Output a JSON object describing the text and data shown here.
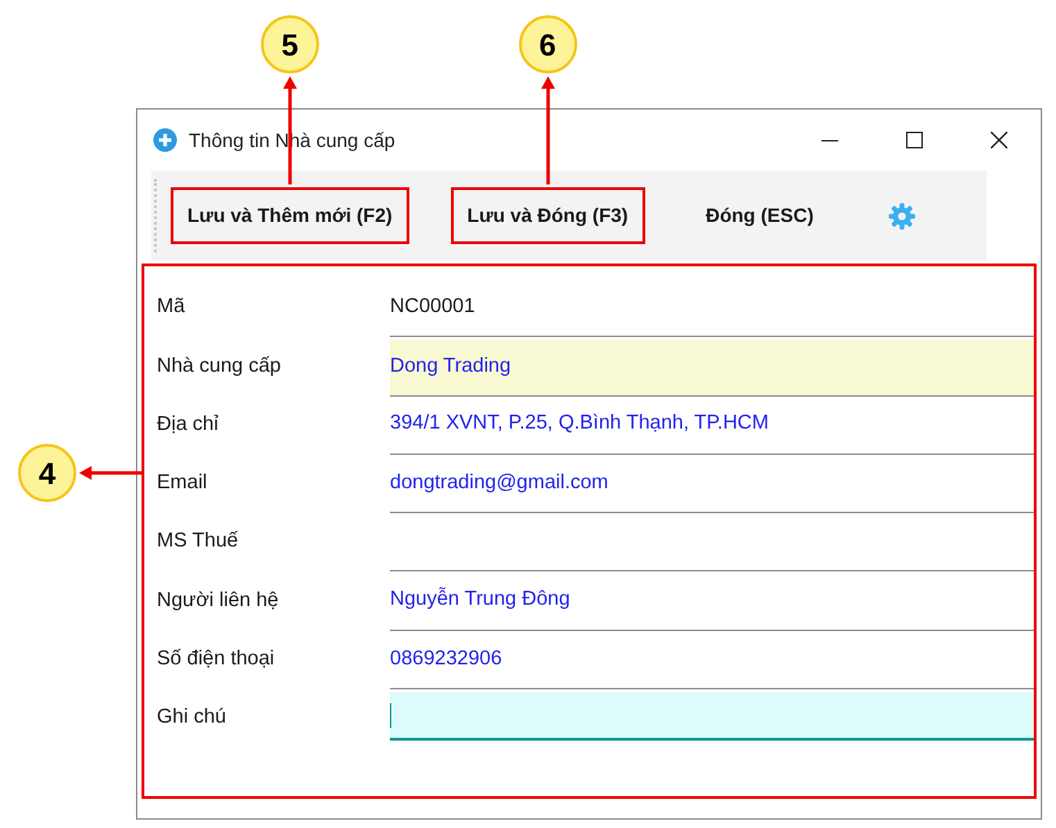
{
  "window": {
    "title": "Thông tin Nhà cung cấp"
  },
  "toolbar": {
    "buttons": [
      {
        "label": "Lưu và Thêm mới (F2)",
        "highlighted": true,
        "callout": "5"
      },
      {
        "label": "Lưu và Đóng (F3)",
        "highlighted": true,
        "callout": "6"
      },
      {
        "label": "Đóng (ESC)",
        "highlighted": false
      }
    ]
  },
  "form": {
    "highlighted": true,
    "callout": "4",
    "fields": [
      {
        "label": "Mã",
        "value": "NC00001",
        "kind": "readonly",
        "focused": false
      },
      {
        "label": "Nhà cung cấp",
        "value": "Dong Trading",
        "kind": "required",
        "focused": false
      },
      {
        "label": "Địa chỉ",
        "value": "394/1 XVNT, P.25, Q.Bình Thạnh, TP.HCM",
        "kind": "text",
        "focused": false
      },
      {
        "label": "Email",
        "value": "dongtrading@gmail.com",
        "kind": "text",
        "focused": false
      },
      {
        "label": "MS Thuế",
        "kind": "text",
        "focused": false
      },
      {
        "label": "Người liên hệ",
        "value": "Nguyễn Trung Đông",
        "kind": "text",
        "focused": false
      },
      {
        "label": "Số điện thoại",
        "value": "0869232906",
        "kind": "text",
        "focused": false
      },
      {
        "label": "Ghi chú",
        "kind": "text",
        "focused": true
      }
    ]
  }
}
